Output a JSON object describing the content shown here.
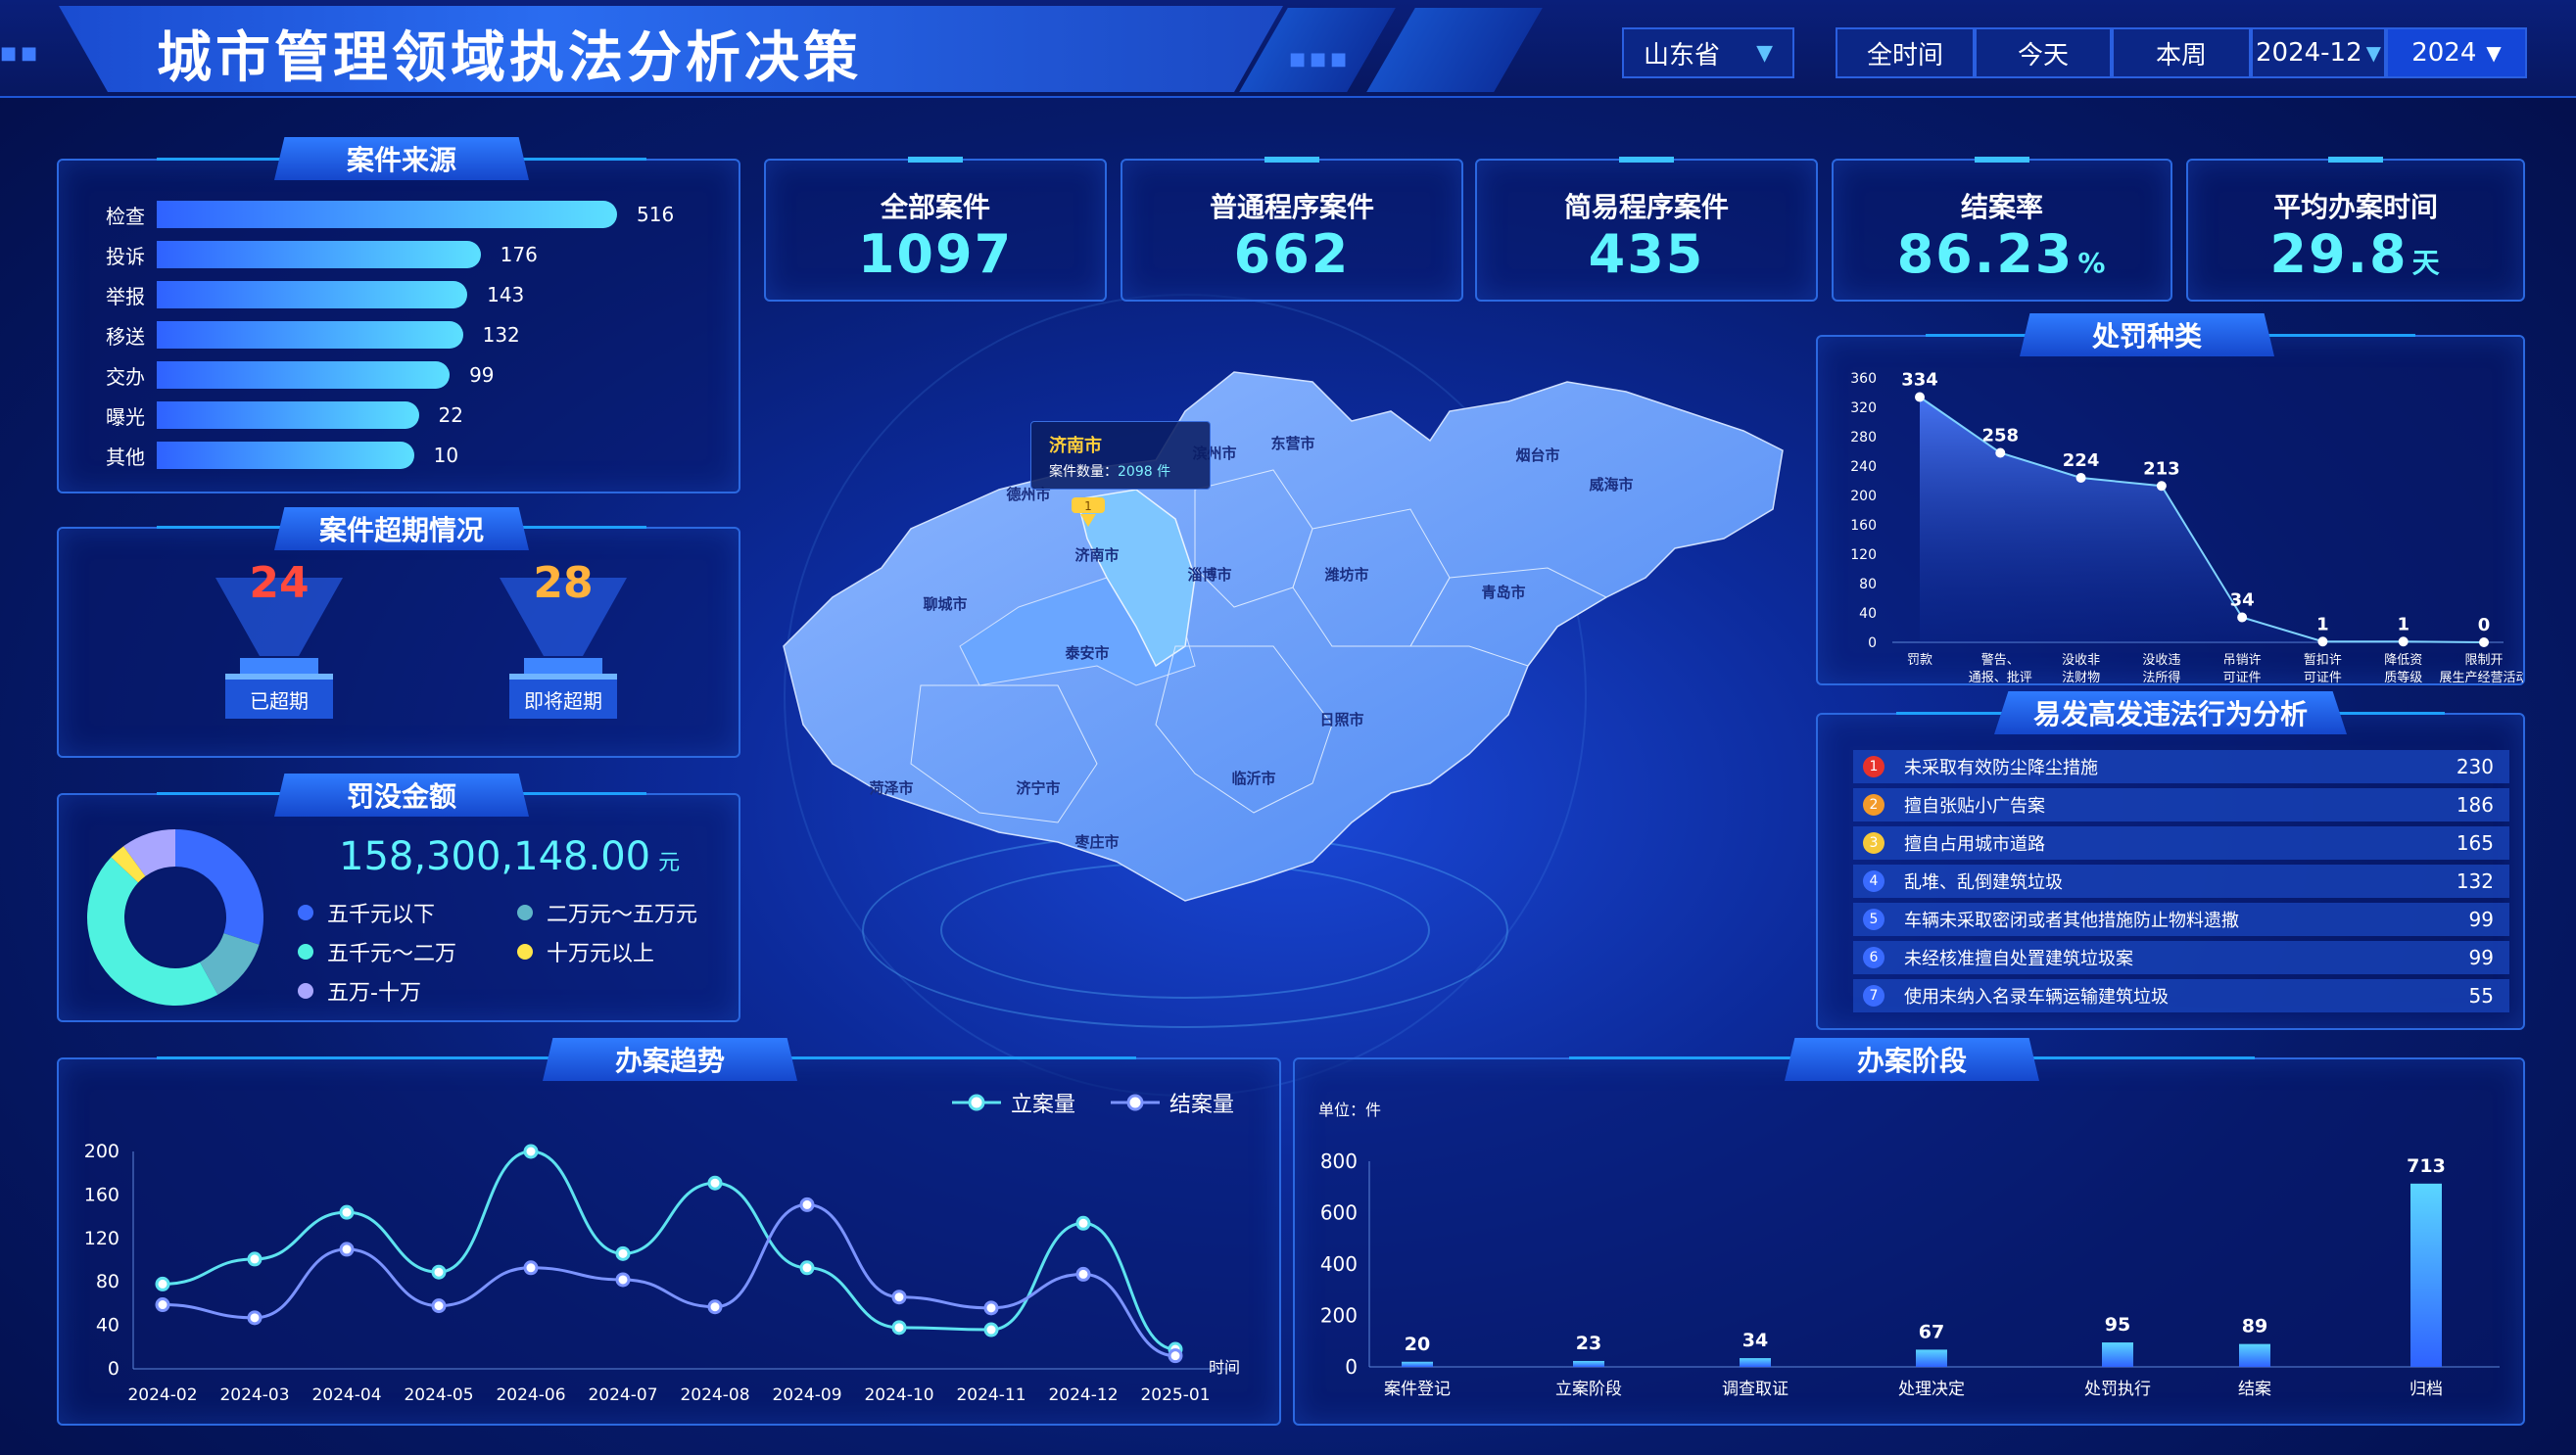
{
  "header": {
    "title": "城市管理领域执法分析决策",
    "province": "山东省",
    "time_tabs": [
      "全时间",
      "今天",
      "本周"
    ],
    "month": "2024-12",
    "year": "2024"
  },
  "colors": {
    "accent": "#5ff3ff",
    "brand": "#1446d8",
    "overdue": "#ff4a3d",
    "due_soon": "#ffb23d"
  },
  "source": {
    "title": "案件来源",
    "items": [
      {
        "label": "检查",
        "value": 516
      },
      {
        "label": "投诉",
        "value": 176
      },
      {
        "label": "举报",
        "value": 143
      },
      {
        "label": "移送",
        "value": 132
      },
      {
        "label": "交办",
        "value": 99
      },
      {
        "label": "曝光",
        "value": 22
      },
      {
        "label": "其他",
        "value": 10
      }
    ]
  },
  "overdue": {
    "title": "案件超期情况",
    "overdue_value": "24",
    "overdue_label": "已超期",
    "soon_value": "28",
    "soon_label": "即将超期"
  },
  "fines": {
    "title": "罚没金额",
    "amount": "158,300,148.00",
    "unit": "元",
    "legend": [
      {
        "label": "五千元以下",
        "color": "#3a6bff"
      },
      {
        "label": "二万元～五万元",
        "color": "#5fb6c9"
      },
      {
        "label": "五千元～二万",
        "color": "#4ff2e0"
      },
      {
        "label": "十万元以上",
        "color": "#ffe54a"
      },
      {
        "label": "五万-十万",
        "color": "#a9a6ff"
      }
    ],
    "slices": [
      0.3,
      0.12,
      0.45,
      0.03,
      0.1
    ]
  },
  "kpis": [
    {
      "label": "全部案件",
      "value": "1097",
      "unit": ""
    },
    {
      "label": "普通程序案件",
      "value": "662",
      "unit": ""
    },
    {
      "label": "简易程序案件",
      "value": "435",
      "unit": ""
    },
    {
      "label": "结案率",
      "value": "86.23",
      "unit": "%"
    },
    {
      "label": "平均办案时间",
      "value": "29.8",
      "unit": "天"
    }
  ],
  "map": {
    "tooltip_city": "济南市",
    "tooltip_label": "案件数量：",
    "tooltip_value": "2098 件",
    "pin": "1",
    "cities": [
      "德州市",
      "济南市",
      "聊城市",
      "泰安市",
      "淄博市",
      "滨州市",
      "东营市",
      "潍坊市",
      "烟台市",
      "威海市",
      "青岛市",
      "日照市",
      "临沂市",
      "菏泽市",
      "济宁市",
      "枣庄市"
    ]
  },
  "penalty": {
    "title": "处罚种类",
    "chart_data": {
      "type": "area",
      "categories": [
        "罚款",
        "警告、通报、批评",
        "没收非法财物",
        "没收违法所得",
        "吊销许可证件",
        "暂扣许可证件",
        "降低资质等级",
        "限制开展生产经营活动"
      ],
      "values": [
        334,
        258,
        224,
        213,
        34,
        1,
        1,
        0
      ],
      "ylim": [
        0,
        360
      ],
      "yticks": [
        0,
        40,
        80,
        120,
        160,
        200,
        240,
        280,
        320,
        360
      ],
      "category_lines": [
        [
          "罚款"
        ],
        [
          "警告、",
          "通报、批评"
        ],
        [
          "没收非",
          "法财物"
        ],
        [
          "没收违",
          "法所得"
        ],
        [
          "吊销许",
          "可证件"
        ],
        [
          "暂扣许",
          "可证件"
        ],
        [
          "降低资",
          "质等级"
        ],
        [
          "限制开",
          "展生产经营活动"
        ]
      ]
    }
  },
  "violations": {
    "title": "易发高发违法行为分析",
    "items": [
      {
        "rank": "1",
        "label": "未采取有效防尘降尘措施",
        "value": "230",
        "color": "#e8322b"
      },
      {
        "rank": "2",
        "label": "擅自张贴小广告案",
        "value": "186",
        "color": "#f39a2a"
      },
      {
        "rank": "3",
        "label": "擅自占用城市道路",
        "value": "165",
        "color": "#f5c83a"
      },
      {
        "rank": "4",
        "label": "乱堆、乱倒建筑垃圾",
        "value": "132",
        "color": "#3a6bff"
      },
      {
        "rank": "5",
        "label": "车辆未采取密闭或者其他措施防止物料遗撒",
        "value": "99",
        "color": "#3a6bff"
      },
      {
        "rank": "6",
        "label": "未经核准擅自处置建筑垃圾案",
        "value": "99",
        "color": "#3a6bff"
      },
      {
        "rank": "7",
        "label": "使用未纳入名录车辆运输建筑垃圾",
        "value": "55",
        "color": "#3a6bff"
      }
    ]
  },
  "trend": {
    "title": "办案趋势",
    "legend_filed": "立案量",
    "legend_closed": "结案量",
    "x_unit": "时间",
    "chart_data": {
      "type": "line",
      "categories": [
        "2024-02",
        "2024-03",
        "2024-04",
        "2024-05",
        "2024-06",
        "2024-07",
        "2024-08",
        "2024-09",
        "2024-10",
        "2024-11",
        "2024-12",
        "2025-01"
      ],
      "ylim": [
        0,
        200
      ],
      "yticks": [
        0,
        40,
        80,
        120,
        160,
        200
      ],
      "series": [
        {
          "name": "立案量",
          "values": [
            78,
            101,
            144,
            89,
            200,
            106,
            171,
            93,
            38,
            36,
            134,
            18
          ],
          "color": "#5de3f0"
        },
        {
          "name": "结案量",
          "values": [
            59,
            47,
            110,
            58,
            93,
            82,
            57,
            151,
            66,
            56,
            87,
            12
          ],
          "color": "#7b93ff"
        }
      ]
    }
  },
  "stage": {
    "title": "办案阶段",
    "unit_label": "单位：件",
    "chart_data": {
      "type": "bar",
      "categories": [
        "案件登记",
        "立案阶段",
        "调查取证",
        "处理决定",
        "处罚执行",
        "结案",
        "归档"
      ],
      "values": [
        20,
        23,
        34,
        67,
        95,
        89,
        713
      ],
      "ylim": [
        0,
        800
      ],
      "yticks": [
        0,
        200,
        400,
        600,
        800
      ]
    }
  }
}
